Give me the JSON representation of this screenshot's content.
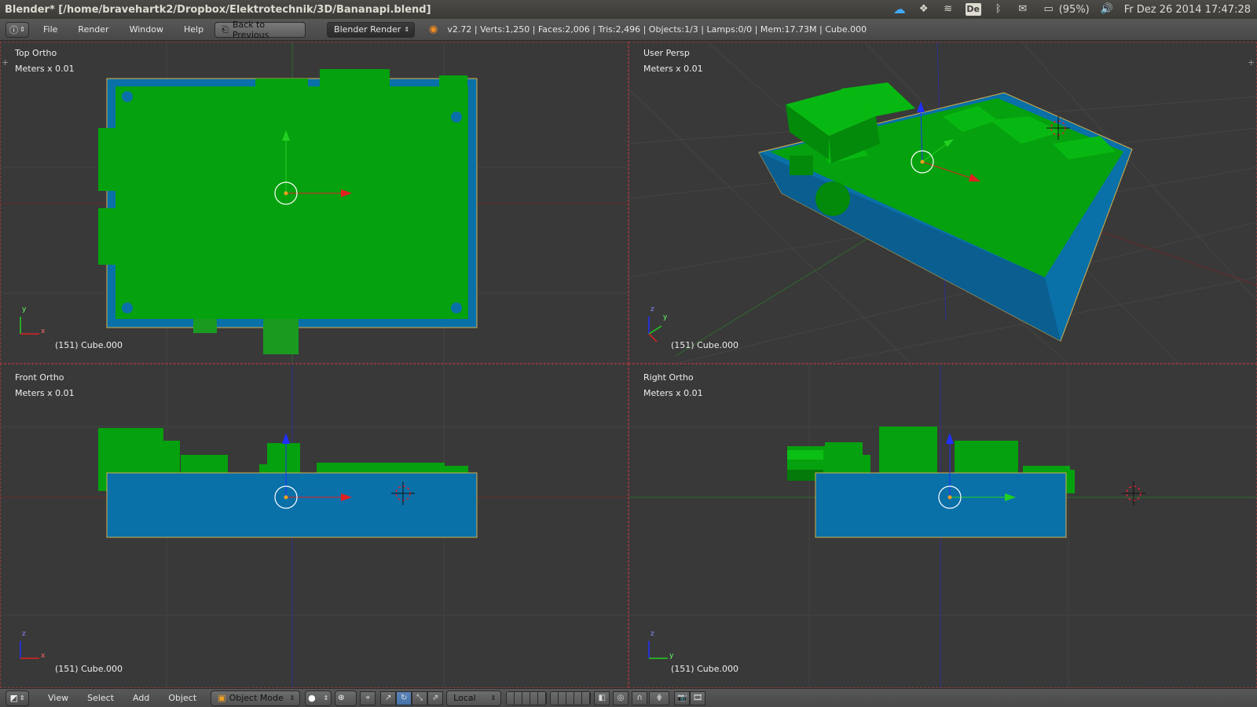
{
  "system_bar": {
    "window_title": "Blender* [/home/bravehartk2/Dropbox/Elektrotechnik/3D/Bananapi.blend]",
    "keyboard_layout": "De",
    "battery": "(95%)",
    "datetime": "Fr Dez 26 2014 17:47:28",
    "tray_icons": [
      "cloud-icon",
      "dropbox-icon",
      "wifi-icon",
      "keyboard-layout-icon",
      "bluetooth-icon",
      "mail-icon",
      "battery-icon",
      "volume-icon"
    ]
  },
  "info_header": {
    "menus": [
      "File",
      "Render",
      "Window",
      "Help"
    ],
    "back_button": "Back to Previous",
    "render_engine": "Blender Render",
    "stats": "v2.72 | Verts:1,250 | Faces:2,006 | Tris:2,496 | Objects:1/3 | Lamps:0/0 | Mem:17.73M | Cube.000"
  },
  "viewports": {
    "top": {
      "name": "Top Ortho",
      "units": "Meters x 0.01",
      "object": "(151) Cube.000",
      "axis_a": "y",
      "axis_b": "x"
    },
    "persp": {
      "name": "User Persp",
      "units": "Meters x 0.01",
      "object": "(151) Cube.000",
      "axis_a": "z",
      "axis_b": "y"
    },
    "front": {
      "name": "Front Ortho",
      "units": "Meters x 0.01",
      "object": "(151) Cube.000",
      "axis_a": "z",
      "axis_b": "x"
    },
    "right": {
      "name": "Right Ortho",
      "units": "Meters x 0.01",
      "object": "(151) Cube.000",
      "axis_a": "z",
      "axis_b": "y"
    }
  },
  "view3d_header": {
    "menus": [
      "View",
      "Select",
      "Add",
      "Object"
    ],
    "mode": "Object Mode",
    "orientation": "Local"
  },
  "colors": {
    "green": "#06a10e",
    "blue": "#0a70a8",
    "background": "#393939",
    "grid": "#444444"
  }
}
